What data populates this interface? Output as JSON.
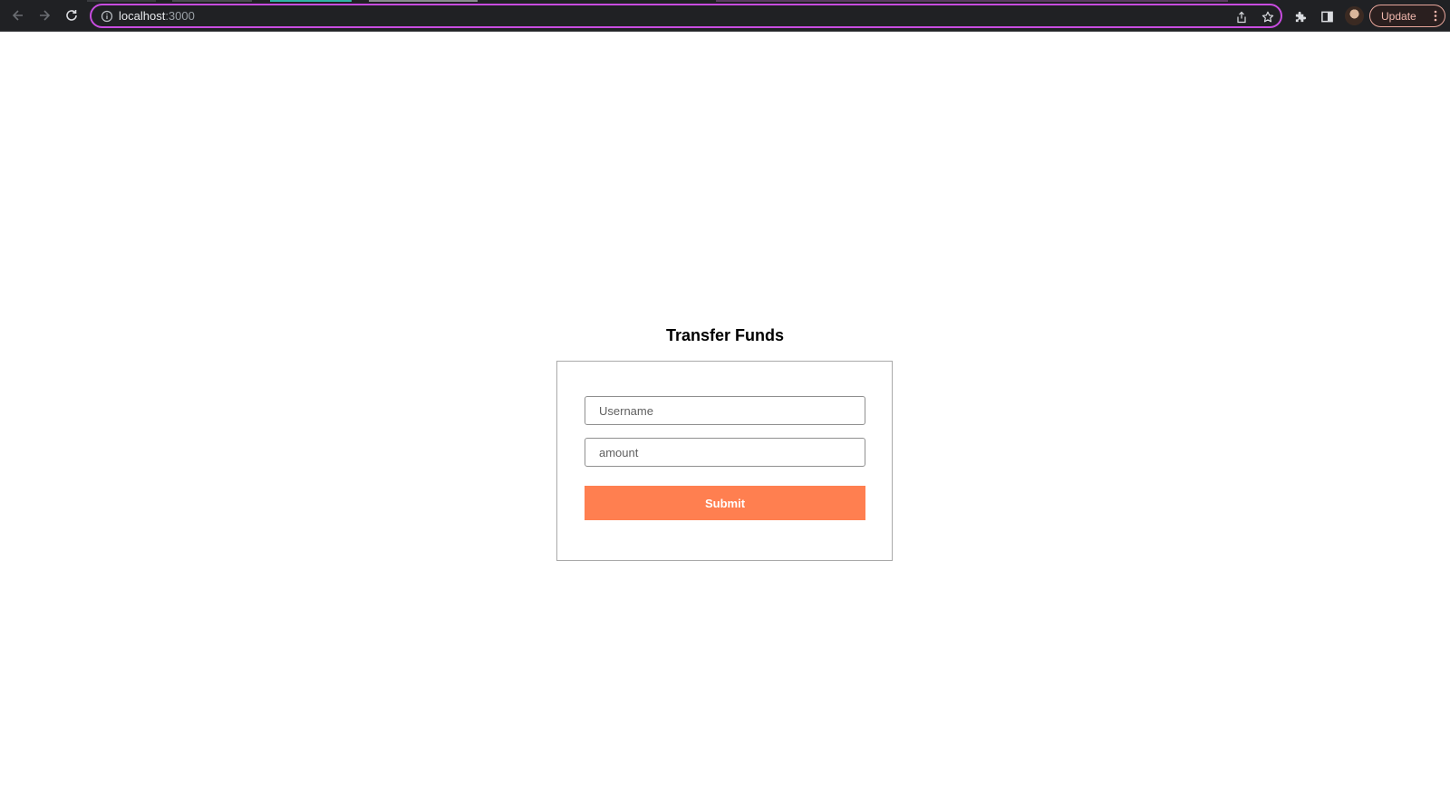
{
  "browser": {
    "url_host": "localhost",
    "url_port": ":3000",
    "update_label": "Update",
    "icons": {
      "back": "back-arrow-icon",
      "forward": "forward-arrow-icon",
      "reload": "reload-icon",
      "site_info": "info-icon",
      "share": "share-icon",
      "bookmark": "star-icon",
      "extensions": "puzzle-icon",
      "side_panel": "side-panel-icon",
      "menu": "kebab-menu-icon"
    },
    "colors": {
      "toolbar_bg": "#202124",
      "omnibox_border": "#c84ce0",
      "update_text": "#f2b8ae"
    }
  },
  "page": {
    "title": "Transfer Funds",
    "form": {
      "username_placeholder": "Username",
      "username_value": "",
      "amount_placeholder": "amount",
      "amount_value": "",
      "submit_label": "Submit"
    },
    "colors": {
      "submit_bg": "#ff7f50"
    }
  }
}
